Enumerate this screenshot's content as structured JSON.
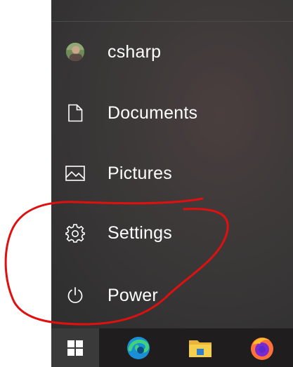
{
  "menu": {
    "user": {
      "label": "csharp",
      "icon": "avatar"
    },
    "items": [
      {
        "label": "Documents",
        "icon": "document-icon"
      },
      {
        "label": "Pictures",
        "icon": "picture-icon"
      },
      {
        "label": "Settings",
        "icon": "gear-icon"
      },
      {
        "label": "Power",
        "icon": "power-icon"
      }
    ]
  },
  "taskbar": {
    "icons": [
      "windows-start-icon",
      "edge-icon",
      "file-explorer-icon",
      "firefox-icon"
    ]
  },
  "annotation": {
    "color": "#e01010",
    "shape": "hand-drawn circle around Settings and Power"
  }
}
